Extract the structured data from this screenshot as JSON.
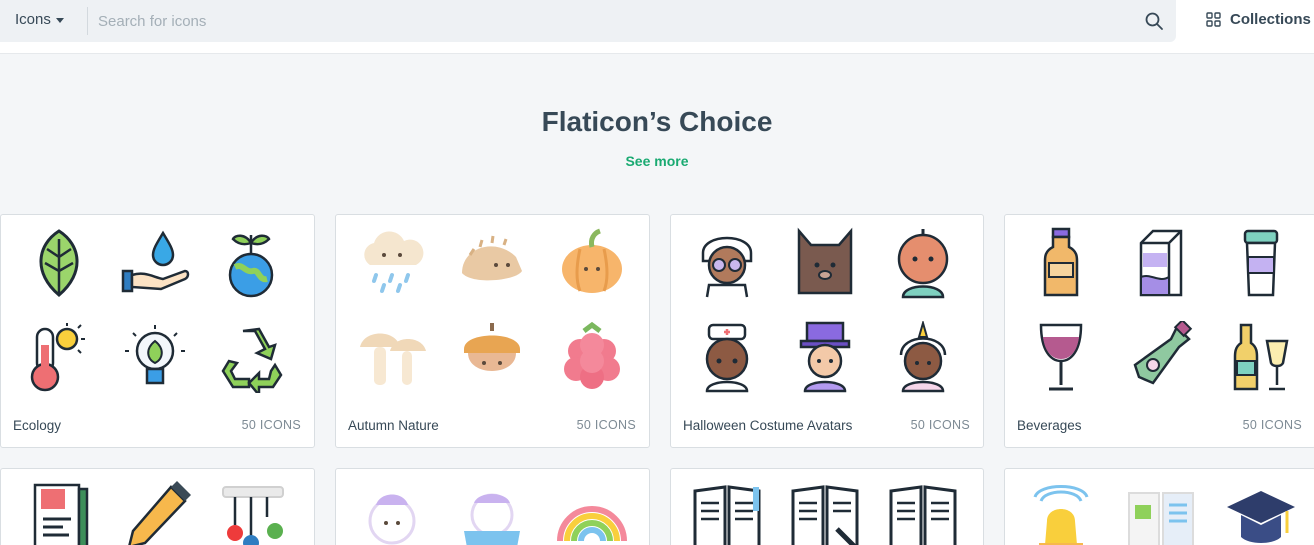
{
  "search": {
    "type_label": "Icons",
    "placeholder": "Search for icons",
    "value": ""
  },
  "header": {
    "collections_label": "Collections"
  },
  "section": {
    "title": "Flaticon’s Choice",
    "see_more": "See more"
  },
  "packs": [
    {
      "title": "Ecology",
      "count": "50 ICONS"
    },
    {
      "title": "Autumn Nature",
      "count": "50 ICONS"
    },
    {
      "title": "Halloween Costume Avatars",
      "count": "50 ICONS"
    },
    {
      "title": "Beverages",
      "count": "50 ICONS"
    }
  ],
  "colors": {
    "accent": "#1aaa72",
    "text": "#374957",
    "background": "#f4f6f8"
  }
}
